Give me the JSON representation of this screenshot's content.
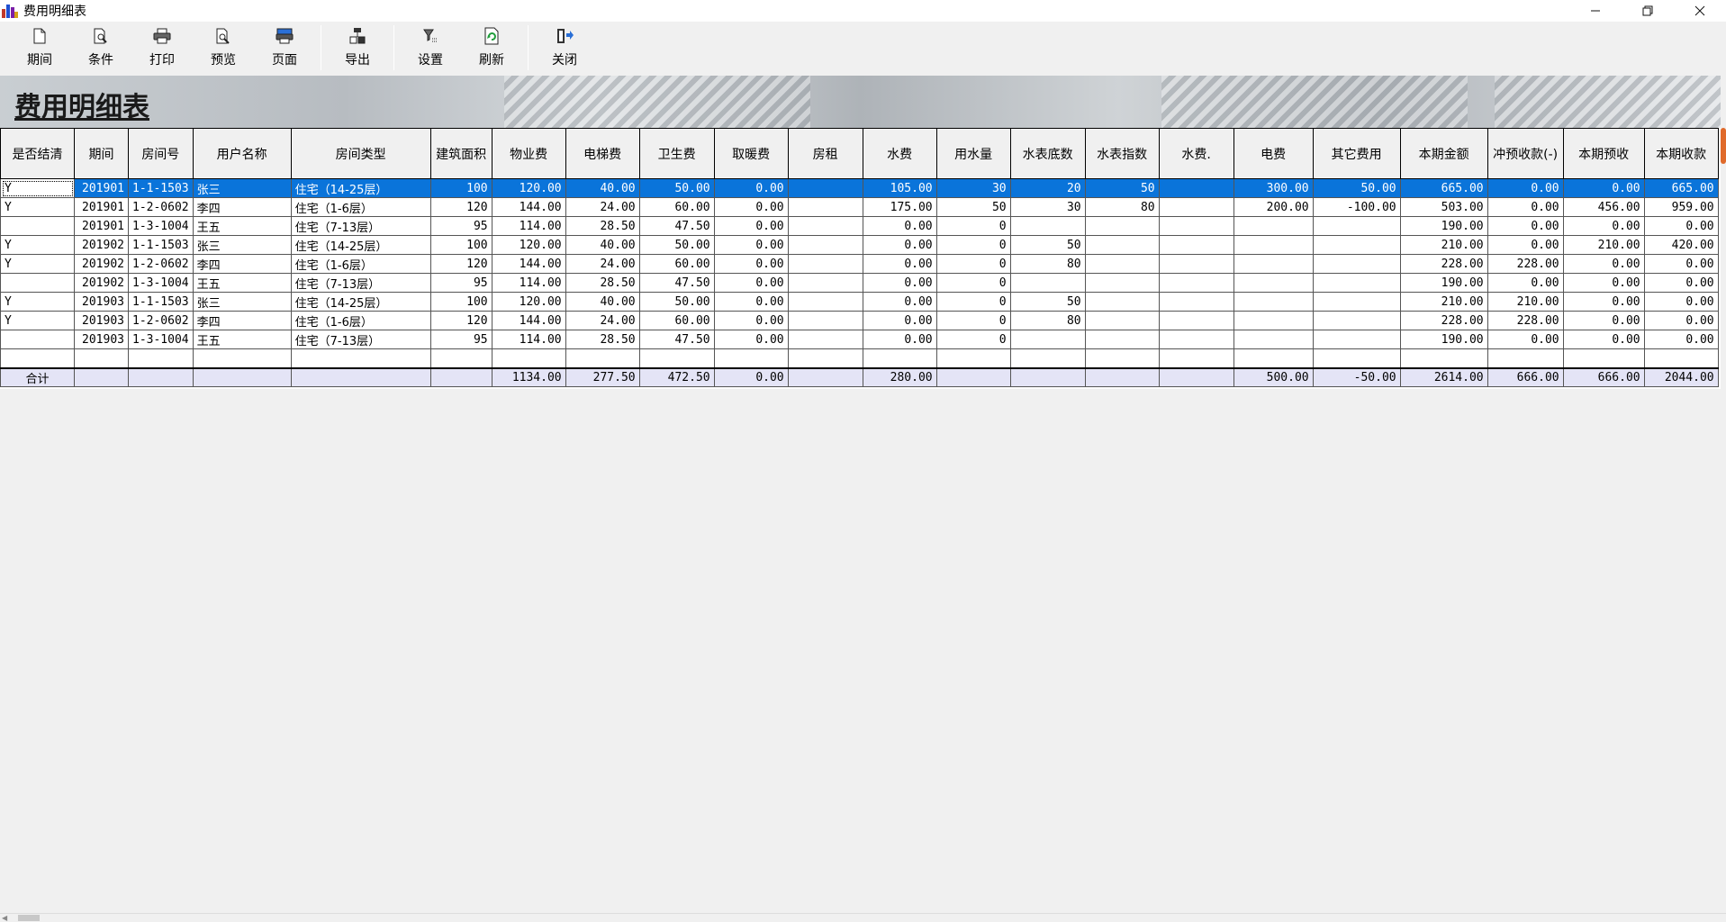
{
  "window": {
    "title": "费用明细表"
  },
  "toolbar": {
    "buttons": [
      {
        "label": "期间",
        "icon": "document-icon"
      },
      {
        "label": "条件",
        "icon": "search-doc-icon"
      },
      {
        "label": "打印",
        "icon": "printer-icon"
      },
      {
        "label": "预览",
        "icon": "preview-icon"
      },
      {
        "label": "页面",
        "icon": "page-setup-icon"
      },
      {
        "label": "导出",
        "icon": "export-icon"
      },
      {
        "label": "设置",
        "icon": "settings-icon"
      },
      {
        "label": "刷新",
        "icon": "refresh-icon"
      },
      {
        "label": "关闭",
        "icon": "exit-icon"
      }
    ]
  },
  "banner": {
    "title": "费用明细表"
  },
  "table": {
    "headers": [
      "是否结清",
      "期间",
      "房间号",
      "用户名称",
      "房间类型",
      "建筑面积",
      "物业费",
      "电梯费",
      "卫生费",
      "取暖费",
      "房租",
      "水费",
      "用水量",
      "水表底数",
      "水表指数",
      "水费.",
      "电费",
      "其它费用",
      "本期金额",
      "冲预收款(-)",
      "本期预收",
      "本期收款"
    ],
    "rows": [
      [
        "Y",
        "201901",
        "1-1-1503",
        "张三",
        "住宅（14-25层）",
        "100",
        "120.00",
        "40.00",
        "50.00",
        "0.00",
        "",
        "105.00",
        "30",
        "20",
        "50",
        "",
        "300.00",
        "50.00",
        "665.00",
        "0.00",
        "0.00",
        "665.00"
      ],
      [
        "Y",
        "201901",
        "1-2-0602",
        "李四",
        "住宅（1-6层）",
        "120",
        "144.00",
        "24.00",
        "60.00",
        "0.00",
        "",
        "175.00",
        "50",
        "30",
        "80",
        "",
        "200.00",
        "-100.00",
        "503.00",
        "0.00",
        "456.00",
        "959.00"
      ],
      [
        "",
        "201901",
        "1-3-1004",
        "王五",
        "住宅（7-13层）",
        "95",
        "114.00",
        "28.50",
        "47.50",
        "0.00",
        "",
        "0.00",
        "0",
        "",
        "",
        "",
        "",
        "",
        "190.00",
        "0.00",
        "0.00",
        "0.00"
      ],
      [
        "Y",
        "201902",
        "1-1-1503",
        "张三",
        "住宅（14-25层）",
        "100",
        "120.00",
        "40.00",
        "50.00",
        "0.00",
        "",
        "0.00",
        "0",
        "50",
        "",
        "",
        "",
        "",
        "210.00",
        "0.00",
        "210.00",
        "420.00"
      ],
      [
        "Y",
        "201902",
        "1-2-0602",
        "李四",
        "住宅（1-6层）",
        "120",
        "144.00",
        "24.00",
        "60.00",
        "0.00",
        "",
        "0.00",
        "0",
        "80",
        "",
        "",
        "",
        "",
        "228.00",
        "228.00",
        "0.00",
        "0.00"
      ],
      [
        "",
        "201902",
        "1-3-1004",
        "王五",
        "住宅（7-13层）",
        "95",
        "114.00",
        "28.50",
        "47.50",
        "0.00",
        "",
        "0.00",
        "0",
        "",
        "",
        "",
        "",
        "",
        "190.00",
        "0.00",
        "0.00",
        "0.00"
      ],
      [
        "Y",
        "201903",
        "1-1-1503",
        "张三",
        "住宅（14-25层）",
        "100",
        "120.00",
        "40.00",
        "50.00",
        "0.00",
        "",
        "0.00",
        "0",
        "50",
        "",
        "",
        "",
        "",
        "210.00",
        "210.00",
        "0.00",
        "0.00"
      ],
      [
        "Y",
        "201903",
        "1-2-0602",
        "李四",
        "住宅（1-6层）",
        "120",
        "144.00",
        "24.00",
        "60.00",
        "0.00",
        "",
        "0.00",
        "0",
        "80",
        "",
        "",
        "",
        "",
        "228.00",
        "228.00",
        "0.00",
        "0.00"
      ],
      [
        "",
        "201903",
        "1-3-1004",
        "王五",
        "住宅（7-13层）",
        "95",
        "114.00",
        "28.50",
        "47.50",
        "0.00",
        "",
        "0.00",
        "0",
        "",
        "",
        "",
        "",
        "",
        "190.00",
        "0.00",
        "0.00",
        "0.00"
      ],
      [
        "",
        "",
        "",
        "",
        "",
        "",
        "",
        "",
        "",
        "",
        "",
        "",
        "",
        "",
        "",
        "",
        "",
        "",
        "",
        "",
        "",
        ""
      ]
    ],
    "total": [
      "合计",
      "",
      "",
      "",
      "",
      "",
      "1134.00",
      "277.50",
      "472.50",
      "0.00",
      "",
      "280.00",
      "",
      "",
      "",
      "",
      "500.00",
      "-50.00",
      "2614.00",
      "666.00",
      "666.00",
      "2044.00"
    ]
  }
}
